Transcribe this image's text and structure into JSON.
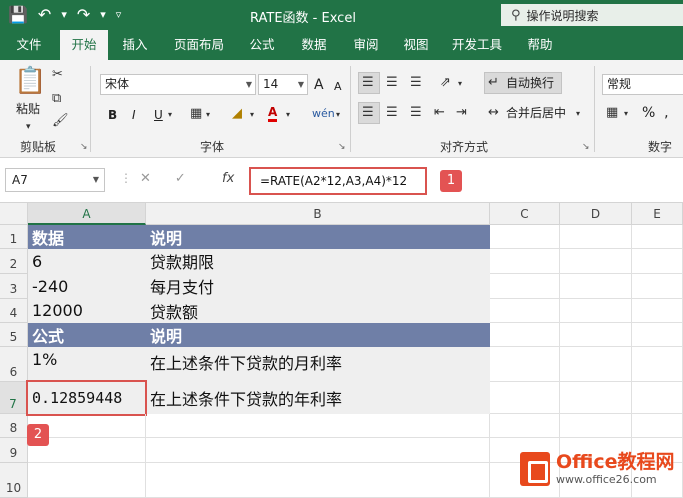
{
  "titlebar": {
    "title": "RATE函数  -  Excel",
    "search_placeholder": "操作说明搜索",
    "icons": [
      "save-icon",
      "undo-icon",
      "redo-icon",
      "customize-qat-icon",
      "lightbulb-search-icon"
    ]
  },
  "tabs": [
    {
      "label": "文件"
    },
    {
      "label": "开始",
      "active": true
    },
    {
      "label": "插入"
    },
    {
      "label": "页面布局"
    },
    {
      "label": "公式"
    },
    {
      "label": "数据"
    },
    {
      "label": "审阅"
    },
    {
      "label": "视图"
    },
    {
      "label": "开发工具"
    },
    {
      "label": "帮助"
    }
  ],
  "ribbon": {
    "clipboard": {
      "paste": "粘贴",
      "group": "剪贴板"
    },
    "font": {
      "name": "宋体",
      "size": "14",
      "group": "字体",
      "bold": "B",
      "italic": "I",
      "underline": "U",
      "size_up": "A",
      "size_down": "A"
    },
    "alignment": {
      "wrap": "自动换行",
      "merge": "合并后居中",
      "group": "对齐方式"
    },
    "number": {
      "format": "常规",
      "group": "数字",
      "percent": "%"
    }
  },
  "formula_bar": {
    "name_box": "A7",
    "fx": "fx",
    "formula": "=RATE(A2*12,A3,A4)*12"
  },
  "annotations": {
    "badge1": "1",
    "badge2": "2"
  },
  "sheet": {
    "columns": [
      "A",
      "B",
      "C",
      "D",
      "E"
    ],
    "rows": [
      "1",
      "2",
      "3",
      "4",
      "5",
      "6",
      "7",
      "8",
      "9",
      "10"
    ],
    "cells": {
      "a1": "数据",
      "b1": "说明",
      "a2": "6",
      "b2": "贷款期限",
      "a3": "-240",
      "b3": "每月支付",
      "a4": "12000",
      "b4": "贷款额",
      "a5": "公式",
      "b5": "说明",
      "a6": "1%",
      "b6": "在上述条件下贷款的月利率",
      "a7": "0.12859448",
      "b7": "在上述条件下贷款的年利率"
    }
  },
  "watermark": {
    "main": "Office教程网",
    "sub": "www.office26.com"
  },
  "colors": {
    "excel_green": "#217346",
    "table_header": "#6f7fa7",
    "callout_red": "#d9534f"
  }
}
